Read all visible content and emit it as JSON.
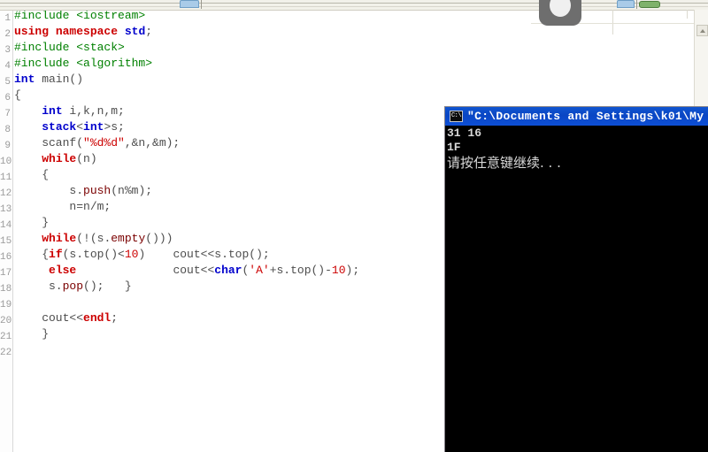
{
  "editor": {
    "gutter_name": "line-number-gutter",
    "lines": [
      {
        "n": "1",
        "tokens": [
          {
            "t": "#include ",
            "c": "pre"
          },
          {
            "t": "<iostream>",
            "c": "pre"
          }
        ]
      },
      {
        "n": "2",
        "tokens": [
          {
            "t": "using",
            "c": "k"
          },
          {
            "t": " ",
            "c": "pln"
          },
          {
            "t": "namespace",
            "c": "k"
          },
          {
            "t": " ",
            "c": "pln"
          },
          {
            "t": "std",
            "c": "typ"
          },
          {
            "t": ";",
            "c": "pln"
          }
        ]
      },
      {
        "n": "3",
        "tokens": [
          {
            "t": "#include ",
            "c": "pre"
          },
          {
            "t": "<stack>",
            "c": "pre"
          }
        ]
      },
      {
        "n": "4",
        "tokens": [
          {
            "t": "#include ",
            "c": "pre"
          },
          {
            "t": "<algorithm>",
            "c": "pre"
          }
        ]
      },
      {
        "n": "5",
        "tokens": [
          {
            "t": "int",
            "c": "typ"
          },
          {
            "t": " main()",
            "c": "pln"
          }
        ]
      },
      {
        "n": "6",
        "tokens": [
          {
            "t": "{",
            "c": "pln"
          }
        ]
      },
      {
        "n": "7",
        "tokens": [
          {
            "t": "    ",
            "c": "pln"
          },
          {
            "t": "int",
            "c": "typ"
          },
          {
            "t": " i,k,n,m;",
            "c": "pln"
          }
        ]
      },
      {
        "n": "8",
        "tokens": [
          {
            "t": "    ",
            "c": "pln"
          },
          {
            "t": "stack",
            "c": "typ"
          },
          {
            "t": "<",
            "c": "pln"
          },
          {
            "t": "int",
            "c": "typ"
          },
          {
            "t": ">s;",
            "c": "pln"
          }
        ]
      },
      {
        "n": "9",
        "tokens": [
          {
            "t": "    scanf(",
            "c": "pln"
          },
          {
            "t": "\"%d%d\"",
            "c": "str"
          },
          {
            "t": ",&n,&m);",
            "c": "pln"
          }
        ]
      },
      {
        "n": "10",
        "tokens": [
          {
            "t": "    ",
            "c": "pln"
          },
          {
            "t": "while",
            "c": "k"
          },
          {
            "t": "(n)",
            "c": "pln"
          }
        ]
      },
      {
        "n": "11",
        "tokens": [
          {
            "t": "    {",
            "c": "pln"
          }
        ]
      },
      {
        "n": "12",
        "tokens": [
          {
            "t": "        s.",
            "c": "pln"
          },
          {
            "t": "push",
            "c": "fn"
          },
          {
            "t": "(n%m);",
            "c": "pln"
          }
        ]
      },
      {
        "n": "13",
        "tokens": [
          {
            "t": "        n=n/m;",
            "c": "pln"
          }
        ]
      },
      {
        "n": "14",
        "tokens": [
          {
            "t": "    }",
            "c": "pln"
          }
        ]
      },
      {
        "n": "15",
        "tokens": [
          {
            "t": "    ",
            "c": "pln"
          },
          {
            "t": "while",
            "c": "k"
          },
          {
            "t": "(!(s.",
            "c": "pln"
          },
          {
            "t": "empty",
            "c": "fn"
          },
          {
            "t": "()))",
            "c": "pln"
          }
        ]
      },
      {
        "n": "16",
        "tokens": [
          {
            "t": "    {",
            "c": "pln"
          },
          {
            "t": "if",
            "c": "k"
          },
          {
            "t": "(s.top()<",
            "c": "pln"
          },
          {
            "t": "10",
            "c": "num"
          },
          {
            "t": ")    cout<<s.top();",
            "c": "pln"
          }
        ]
      },
      {
        "n": "17",
        "tokens": [
          {
            "t": "     ",
            "c": "pln"
          },
          {
            "t": "else",
            "c": "k"
          },
          {
            "t": "              cout<<",
            "c": "pln"
          },
          {
            "t": "char",
            "c": "typ"
          },
          {
            "t": "(",
            "c": "pln"
          },
          {
            "t": "'A'",
            "c": "str"
          },
          {
            "t": "+s.top()-",
            "c": "pln"
          },
          {
            "t": "10",
            "c": "num"
          },
          {
            "t": ");",
            "c": "pln"
          }
        ]
      },
      {
        "n": "18",
        "tokens": [
          {
            "t": "     s.",
            "c": "pln"
          },
          {
            "t": "pop",
            "c": "fn"
          },
          {
            "t": "();   }",
            "c": "pln"
          }
        ]
      },
      {
        "n": "19",
        "tokens": [
          {
            "t": "",
            "c": "pln"
          }
        ]
      },
      {
        "n": "20",
        "tokens": [
          {
            "t": "    cout<<",
            "c": "pln"
          },
          {
            "t": "endl",
            "c": "k"
          },
          {
            "t": ";",
            "c": "pln"
          }
        ]
      },
      {
        "n": "21",
        "tokens": [
          {
            "t": "    }",
            "c": "pln"
          }
        ]
      },
      {
        "n": "22",
        "tokens": [
          {
            "t": "",
            "c": "pln"
          }
        ]
      }
    ],
    "colors": {
      "preprocessor": "#008000",
      "keyword": "#cc0000",
      "type": "#0000cc",
      "string": "#cc0000",
      "number": "#cc0000",
      "plain": "#404040",
      "background": "#ffffff",
      "gutter_text": "#9a9a9a"
    }
  },
  "console": {
    "icon": "console-app-icon",
    "icon_glyph": "C:\\",
    "title": "\"C:\\Documents and Settings\\k01\\My",
    "titlebar_color": "#0a4ad2",
    "background": "#000000",
    "text_color": "#d8d8d8",
    "lines": [
      "31 16",
      "1F",
      "请按任意键继续. . ."
    ]
  },
  "chrome": {
    "scrollbar_up_arrow": "scroll-up-arrow",
    "tab_fragment_blue": "tab-fragment",
    "tab_fragment_green": "toolbar-green-button",
    "cursor_overlay": "cursor-overlay-blob"
  }
}
